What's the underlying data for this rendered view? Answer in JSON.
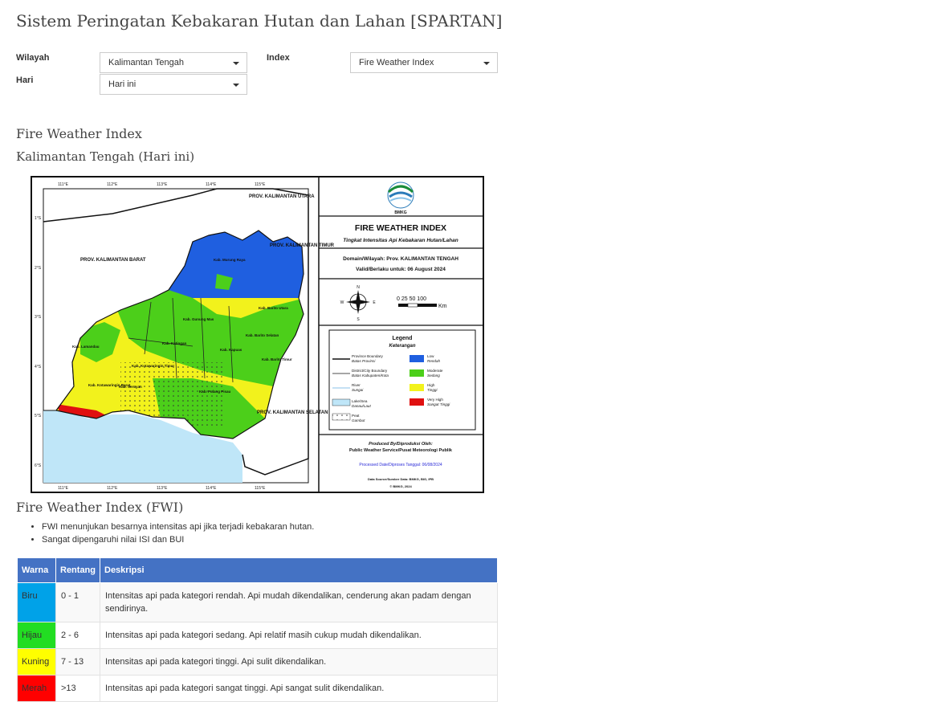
{
  "title": "Sistem Peringatan Kebakaran Hutan dan Lahan [SPARTAN]",
  "filters": {
    "wilayah_label": "Wilayah",
    "wilayah_value": "Kalimantan Tengah",
    "hari_label": "Hari",
    "hari_value": "Hari ini",
    "index_label": "Index",
    "index_value": "Fire Weather Index"
  },
  "section_title": "Fire Weather Index",
  "section_subtitle": "Kalimantan Tengah (Hari ini)",
  "map": {
    "bmkg": "BMKG",
    "title": "FIRE WEATHER INDEX",
    "subtitle": "Tingkat Intensitas Api Kebakaran Hutan/Lahan",
    "domain": "Domain/Wilayah: Prov. KALIMANTAN TENGAH",
    "valid": "Valid/Berlaku untuk: 06 August 2024",
    "scale": "0  25 50     100",
    "scale_unit": "Km",
    "compass": [
      "N",
      "E",
      "S",
      "W"
    ],
    "legend_title": "Legend",
    "legend_subtitle": "Keterangan",
    "legend_lines": [
      {
        "en": "Province Boundary",
        "id": "Batas Provinsi"
      },
      {
        "en": "District/City Boundary",
        "id": "Batas Kabupaten/Kota"
      },
      {
        "en": "River",
        "id": "Sungai"
      },
      {
        "en": "Lake/Sea",
        "id": "Danau/Laut"
      },
      {
        "en": "Peat",
        "id": "Gambut"
      }
    ],
    "legend_classes": [
      {
        "en": "Low",
        "id": "Rendah",
        "color": "#1f5fe0"
      },
      {
        "en": "Moderate",
        "id": "Sedang",
        "color": "#4ccf1a"
      },
      {
        "en": "High",
        "id": "Tinggi",
        "color": "#f2f21c"
      },
      {
        "en": "Very High",
        "id": "Sangat Tinggi",
        "color": "#e01010"
      }
    ],
    "produced_by": "Produced By/Diproduksi Oleh:",
    "producer": "Public Weather Service/Pusat Meteorologi Publik",
    "processed": "Processed Date/Diproses Tanggal: 06/08/2024",
    "source": "Data Source/Sumber Data: BMKG, BIG, IPB",
    "copyright": "© BMKG, 2024",
    "lon_labels": [
      "111°E",
      "112°E",
      "113°E",
      "114°E",
      "115°E"
    ],
    "lat_labels": [
      "1°S",
      "2°S",
      "3°S",
      "4°S",
      "5°S",
      "6°S"
    ],
    "province_labels": [
      "PROV. KALIMANTAN UTARA",
      "PROV. KALIMANTAN TIMUR",
      "PROV. KALIMANTAN BARAT",
      "PROV. KALIMANTAN SELATAN"
    ],
    "district_labels": [
      "Kab. Murung Raya",
      "Kab. Barito Utara",
      "Kab. Gunung Mas",
      "Kab. Lamandau",
      "Kab. Katingan",
      "Kab. Kapuas",
      "Kab. Barito Selatan",
      "Kab. Barito Timur",
      "Kab. Kotawaringin Timur",
      "Kab. Kotawaringin Barat",
      "Kab. Seruyan",
      "Kab. Pulang Pisau"
    ]
  },
  "fwi_title": "Fire Weather Index (FWI)",
  "bullets": [
    "FWI menunjukan besarnya intensitas api jika terjadi kebakaran hutan.",
    "Sangat dipengaruhi nilai ISI dan BUI"
  ],
  "table": {
    "headers": [
      "Warna",
      "Rentang",
      "Deskripsi"
    ],
    "rows": [
      {
        "color_name": "Biru",
        "color": "#00a2e8",
        "text_color": "#333333",
        "range": "0 - 1",
        "desc": "Intensitas api pada kategori rendah. Api mudah dikendalikan, cenderung akan padam dengan sendirinya."
      },
      {
        "color_name": "Hijau",
        "color": "#22dd22",
        "text_color": "#333333",
        "range": "2 - 6",
        "desc": "Intensitas api pada kategori sedang. Api relatif masih cukup mudah dikendalikan."
      },
      {
        "color_name": "Kuning",
        "color": "#ffff00",
        "text_color": "#333333",
        "range": "7 - 13",
        "desc": "Intensitas api pada kategori tinggi. Api sulit dikendalikan."
      },
      {
        "color_name": "Merah",
        "color": "#ff0000",
        "text_color": "#333333",
        "range": ">13",
        "desc": "Intensitas api pada kategori sangat tinggi. Api sangat sulit dikendalikan."
      }
    ]
  }
}
